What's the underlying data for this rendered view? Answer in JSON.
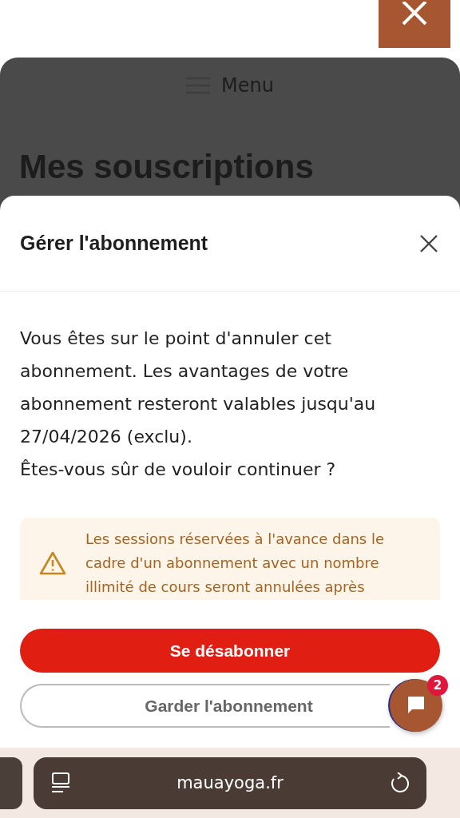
{
  "page": {
    "menu_label": "Menu",
    "title": "Mes souscriptions"
  },
  "modal": {
    "title": "Gérer l'abonnement",
    "message": "Vous êtes sur le point d'annuler cet abonnement. Les avantages de votre abonnement resteront valables jusqu'au 27/04/2026 (exclu).\nÊtes-vous sûr de vouloir continuer ?",
    "warning": "Les sessions réservées à l'avance dans le cadre d'un abonnement avec un nombre illimité de cours seront annulées après",
    "buttons": [
      {
        "label": "Se désabonner",
        "kind": "primary"
      },
      {
        "label": "Garder l'abonnement",
        "kind": "secondary"
      }
    ]
  },
  "chat": {
    "badge": "2"
  },
  "browser": {
    "url": "mauayoga.fr"
  }
}
